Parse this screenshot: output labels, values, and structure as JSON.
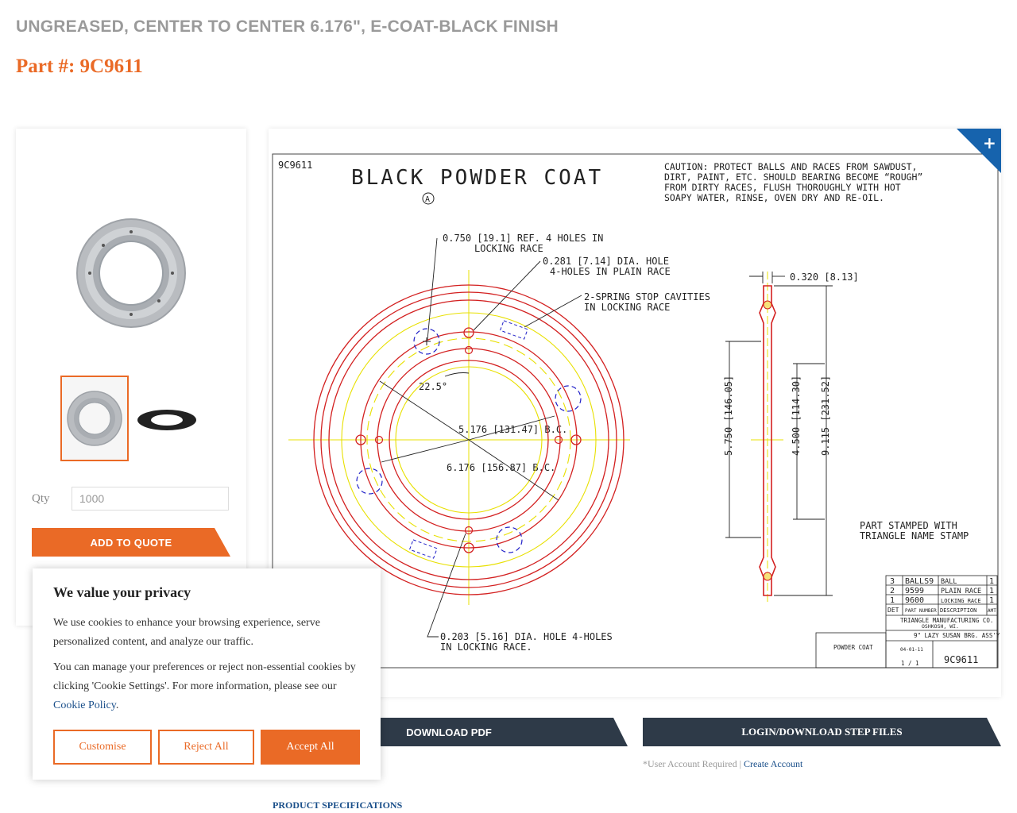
{
  "product": {
    "title": "UNGREASED, CENTER TO CENTER 6.176\", E-COAT-BLACK FINISH",
    "part_label": "Part #: 9C9611"
  },
  "gallery": {
    "main_image_icon": "bearing-photo-icon",
    "thumbnails": [
      {
        "icon": "bearing-thumbnail-icon",
        "selected": true
      },
      {
        "icon": "black-bearing-thumbnail-icon",
        "selected": false
      }
    ]
  },
  "quote": {
    "qty_label": "Qty",
    "qty_value": "1000",
    "add_button": "ADD TO QUOTE"
  },
  "drawing": {
    "zoom_icon": "plus-icon",
    "part_no": "9C9611",
    "heading": "BLACK POWDER COAT",
    "rev": "A",
    "caution": [
      "CAUTION: PROTECT BALLS AND RACES FROM SAWDUST,",
      "DIRT, PAINT, ETC. SHOULD BEARING BECOME “ROUGH”",
      "FROM DIRTY RACES, FLUSH THOROUGHLY WITH HOT",
      "SOAPY WATER, RINSE, OVEN DRY AND RE-OIL."
    ],
    "note_holes_locking": [
      "0.750 [19.1] REF. 4 HOLES IN",
      "LOCKING RACE"
    ],
    "note_holes_plain": [
      "0.281 [7.14] DIA. HOLE",
      "4-HOLES IN PLAIN RACE"
    ],
    "note_spring": [
      "2-SPRING STOP CAVITIES",
      "IN LOCKING RACE"
    ],
    "angle": "22.5°",
    "bc_inner": "5.176 [131.47] B.C.",
    "bc_outer": "6.176 [156.87] B.C.",
    "note_bottom": [
      "0.203 [5.16] DIA. HOLE 4-HOLES",
      "IN LOCKING RACE."
    ],
    "dim_thickness": "0.320 [8.13]",
    "dim_a": "5.750 [146.05]",
    "dim_b": "4.500 [114.30]",
    "dim_c": "9.115 [231.52]",
    "stamp_note": [
      "PART STAMPED WITH",
      "TRIANGLE NAME STAMP"
    ],
    "bom": [
      {
        "det": "3",
        "part": "BALLS9",
        "desc": "BALL",
        "amt": "1"
      },
      {
        "det": "2",
        "part": "9599",
        "desc": "PLAIN RACE",
        "amt": "1"
      },
      {
        "det": "1",
        "part": "9600",
        "desc": "LOCKING RACE",
        "amt": "1"
      }
    ],
    "bom_headers": {
      "det": "DET",
      "part": "PART NUMBER",
      "desc": "DESCRIPTION",
      "amt": "AMT"
    },
    "company": "TRIANGLE MANUFACTURING CO.",
    "city": "OSHKOSH, WI.",
    "title_name": "9\" LAZY SUSAN BRG. ASS'Y",
    "finish": "POWDER COAT",
    "date": "04-01-11",
    "scale": "1 / 1",
    "tb_part": "9C9611"
  },
  "actions": {
    "download_pdf": "DOWNLOAD PDF",
    "login_step": "LOGIN/DOWNLOAD STEP FILES",
    "account_note": "*User Account Required | ",
    "create_account": "Create Account",
    "spec_link": "PRODUCT SPECIFICATIONS"
  },
  "cookie": {
    "title": "We value your privacy",
    "text1": "We use cookies to enhance your browsing experience, serve personalized content, and analyze our traffic.",
    "text2": "You can manage your preferences or reject non-essential cookies by clicking 'Cookie Settings'. For more information, please see our ",
    "policy_link": "Cookie Policy",
    "customise": "Customise",
    "reject": "Reject All",
    "accept": "Accept All"
  },
  "colors": {
    "accent": "#ea6a26",
    "dark_button": "#2e3a48",
    "link": "#1a4f8a"
  }
}
